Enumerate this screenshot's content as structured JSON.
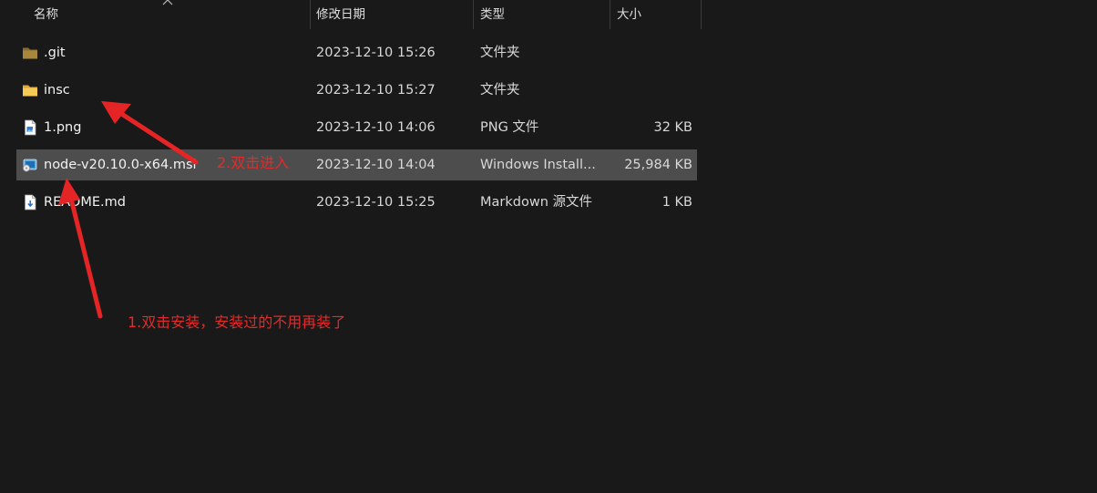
{
  "columns": {
    "name": "名称",
    "modified": "修改日期",
    "type": "类型",
    "size": "大小"
  },
  "files": [
    {
      "name": ".git",
      "modified": "2023-12-10 15:26",
      "type": "文件夹",
      "size": "",
      "icon": "folder-dark-icon",
      "selected": false
    },
    {
      "name": "insc",
      "modified": "2023-12-10 15:27",
      "type": "文件夹",
      "size": "",
      "icon": "folder-icon",
      "selected": false
    },
    {
      "name": "1.png",
      "modified": "2023-12-10 14:06",
      "type": "PNG 文件",
      "size": "32 KB",
      "icon": "image-file-icon",
      "selected": false
    },
    {
      "name": "node-v20.10.0-x64.msi",
      "modified": "2023-12-10 14:04",
      "type": "Windows Install...",
      "size": "25,984 KB",
      "icon": "msi-installer-icon",
      "selected": true
    },
    {
      "name": "README.md",
      "modified": "2023-12-10 15:25",
      "type": "Markdown 源文件",
      "size": "1 KB",
      "icon": "markdown-file-icon",
      "selected": false
    }
  ],
  "annotations": {
    "step1": "1.双击安装，安装过的不用再装了",
    "step2": "2.双击进入"
  },
  "colors": {
    "background": "#191919",
    "selected_row": "#4d4d4d",
    "annotation": "#e32b2b",
    "folder": "#f2c55c"
  }
}
